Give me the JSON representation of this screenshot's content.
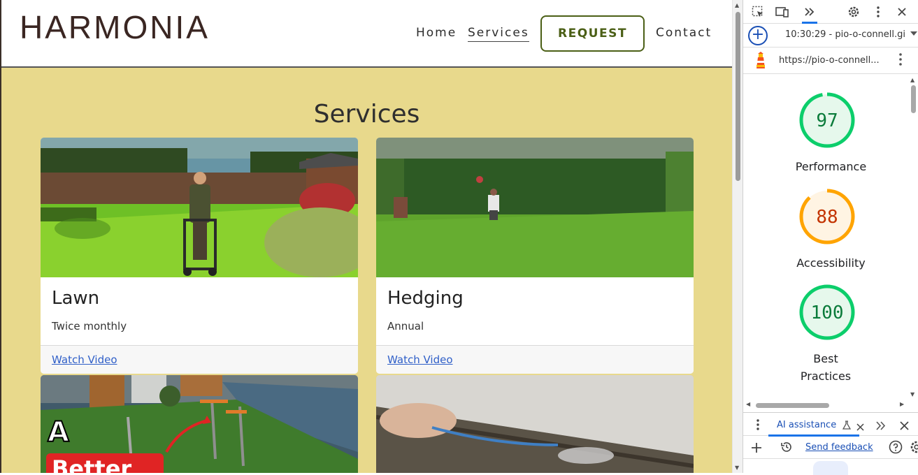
{
  "site": {
    "logo": "HARMONIA",
    "nav": {
      "home": "Home",
      "services": "Services",
      "request": "REQUEST",
      "contact": "Contact"
    },
    "section_title": "Services",
    "cards": [
      {
        "title": "Lawn",
        "subtitle": "Twice monthly",
        "link": "Watch Video"
      },
      {
        "title": "Hedging",
        "subtitle": "Annual",
        "link": "Watch Video"
      }
    ],
    "partial_card_overlay": "A\nBetter"
  },
  "devtools": {
    "session": "10:30:29 - pio-o-connell.gi",
    "url": "https://pio-o-connell...",
    "scores": [
      {
        "value": "97",
        "label": "Performance",
        "fraction": 0.97,
        "color": "#0cce6b",
        "text_color": "#0a7b3a",
        "bg": "#e6f8ec"
      },
      {
        "value": "88",
        "label": "Accessibility",
        "fraction": 0.88,
        "color": "#ffa400",
        "text_color": "#c33300",
        "bg": "#fff4e3"
      },
      {
        "value": "100",
        "label": "Best Practices",
        "fraction": 1.0,
        "color": "#0cce6b",
        "text_color": "#0a7b3a",
        "bg": "#e6f8ec"
      }
    ],
    "drawer": {
      "tab_label": "AI assistance",
      "send_feedback": "Send feedback"
    }
  }
}
